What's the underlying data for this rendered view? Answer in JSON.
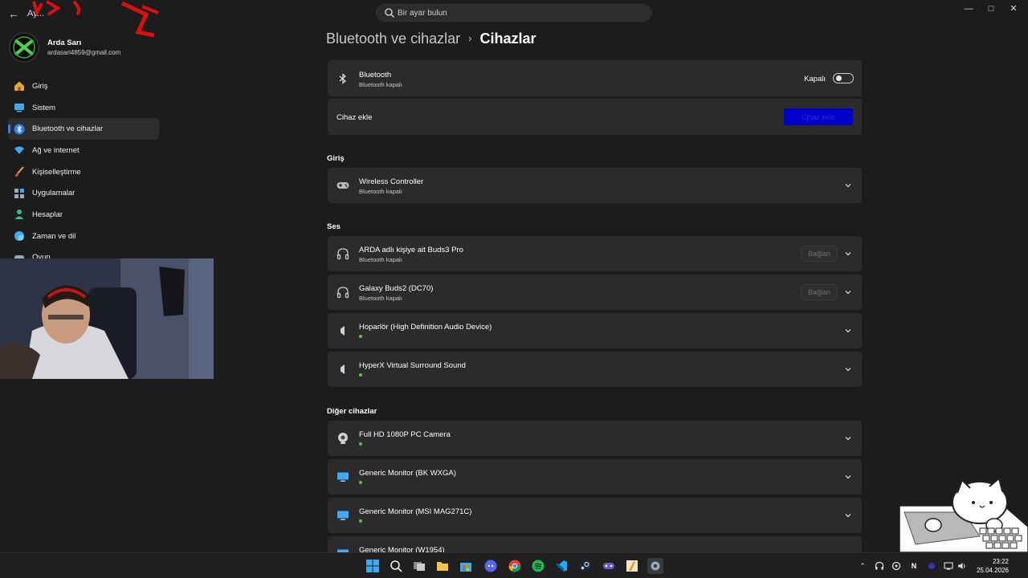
{
  "app": {
    "title": "Ay..."
  },
  "search": {
    "placeholder": "Bir ayar bulun"
  },
  "profile": {
    "name": "Arda Sarı",
    "email": "ardasari4859@gmail.com"
  },
  "sidebar": {
    "items": [
      {
        "label": "Giriş",
        "icon": "home-icon",
        "active": false
      },
      {
        "label": "Sistem",
        "icon": "monitor-icon",
        "active": false
      },
      {
        "label": "Bluetooth ve cihazlar",
        "icon": "bluetooth-icon",
        "active": true
      },
      {
        "label": "Ağ ve internet",
        "icon": "wifi-icon",
        "active": false
      },
      {
        "label": "Kişiselleştirme",
        "icon": "brush-icon",
        "active": false
      },
      {
        "label": "Uygulamalar",
        "icon": "apps-icon",
        "active": false
      },
      {
        "label": "Hesaplar",
        "icon": "person-icon",
        "active": false
      },
      {
        "label": "Zaman ve dil",
        "icon": "globe-icon",
        "active": false
      },
      {
        "label": "Oyun",
        "icon": "gamepad-icon",
        "active": false
      }
    ]
  },
  "breadcrumb": {
    "parent": "Bluetooth ve cihazlar",
    "separator": "›",
    "current": "Cihazlar"
  },
  "bluetooth": {
    "title": "Bluetooth",
    "subtitle": "Bluetooth kapalı",
    "toggle_label": "Kapalı",
    "toggle_on": false
  },
  "add_device": {
    "label": "Cihaz ekle",
    "button_label": "Cihaz ekle"
  },
  "sections": {
    "input": {
      "title": "Giriş",
      "devices": [
        {
          "name": "Wireless Controller",
          "status": "Bluetooth kapalı",
          "icon": "gamepad-icon"
        }
      ]
    },
    "audio": {
      "title": "Ses",
      "devices": [
        {
          "name": "ARDA adlı kişiye ait Buds3 Pro",
          "status": "Bluetooth kapalı",
          "icon": "headphones-icon",
          "button": "Bağlan"
        },
        {
          "name": "Galaxy Buds2 (DC70)",
          "status": "Bluetooth kapalı",
          "icon": "headphones-icon",
          "button": "Bağlan"
        },
        {
          "name": "Hoparlör (High Definition Audio Device)",
          "icon": "speaker-icon",
          "connected": true
        },
        {
          "name": "HyperX Virtual Surround Sound",
          "icon": "speaker-icon",
          "connected": true
        }
      ]
    },
    "other": {
      "title": "Diğer cihazlar",
      "devices": [
        {
          "name": "Full HD 1080P PC Camera",
          "icon": "webcam-icon",
          "connected": true
        },
        {
          "name": "Generic Monitor (BK WXGA)",
          "icon": "monitor-icon",
          "connected": true
        },
        {
          "name": "Generic Monitor (MSI MAG271C)",
          "icon": "monitor-icon",
          "connected": true
        },
        {
          "name": "Generic Monitor (W1954)",
          "icon": "monitor-icon",
          "connected": true
        }
      ]
    }
  },
  "taskbar": {
    "apps": [
      "windows-start-icon",
      "search-icon",
      "task-view-icon",
      "file-explorer-icon",
      "store-icon",
      "discord-icon",
      "chrome-icon",
      "spotify-icon",
      "vscode-icon",
      "steam-icon",
      "game-icon",
      "app-icon",
      "settings-icon"
    ],
    "tray_n": "N",
    "time": "23:22",
    "date": "25.04.2026"
  },
  "colors": {
    "accent": "#2f80ed",
    "connected_dot": "#4ec94e",
    "add_button": "#0000c8",
    "background": "#1c1c1c",
    "card": "#2b2b2b"
  }
}
